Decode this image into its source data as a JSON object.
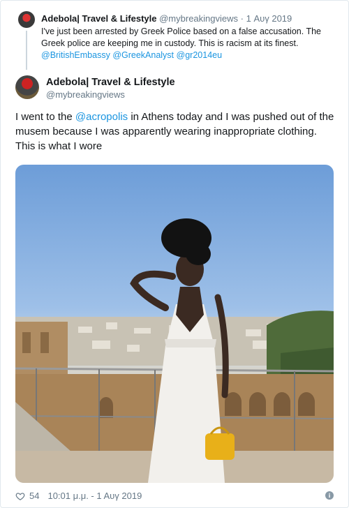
{
  "parent_tweet": {
    "author_name": "Adebola| Travel & Lifestyle",
    "handle": "@mybreakingviews",
    "separator": "·",
    "date": "1 Αυγ 2019",
    "text_parts": [
      "I've just been arrested by Greek Police based on a false accusation. The Greek police are keeping me in custody. This is racism at its finest. "
    ],
    "mentions": [
      "@BritishEmbassy",
      "@GreekAnalyst",
      "@gr2014eu"
    ]
  },
  "tweet": {
    "author_name": "Adebola| Travel & Lifestyle",
    "handle": "@mybreakingviews",
    "text_before": "I went to the ",
    "mention": "@acropolis",
    "text_after": " in Athens today and I was pushed out of the musem because I was apparently wearing inappropriate clothing. This is what I wore",
    "like_count": "54",
    "timestamp": "10:01 μ.μ. - 1 Αυγ 2019"
  },
  "icons": {
    "like": "heart-icon",
    "info": "info-icon"
  },
  "colors": {
    "link": "#1b95e0",
    "secondary_text": "#657786",
    "primary_text": "#14171a"
  }
}
